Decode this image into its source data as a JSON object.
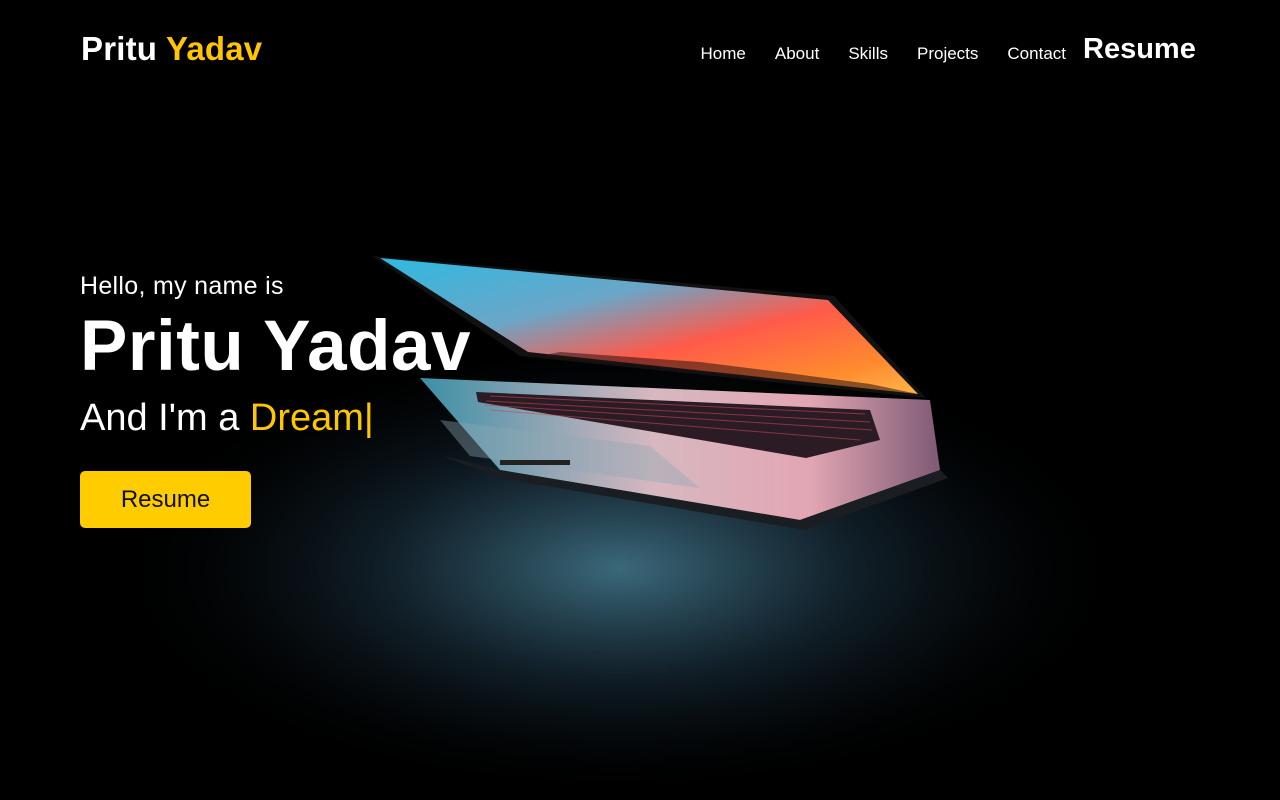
{
  "logo": {
    "first": "Pritu",
    "second": "Yadav",
    "accent_color": "#ffc600"
  },
  "nav": {
    "links": [
      {
        "label": "Home"
      },
      {
        "label": "About"
      },
      {
        "label": "Skills"
      },
      {
        "label": "Projects"
      },
      {
        "label": "Contact"
      }
    ],
    "resume_label": "Resume"
  },
  "hero": {
    "greeting": "Hello, my name is",
    "name": "Pritu Yadav",
    "role_prefix": "And I'm a ",
    "role_typed": "Dream",
    "cursor": "|",
    "button_label": "Resume",
    "button_color": "#ffcc00"
  },
  "background_image": "laptop-half-open-glowing-screen"
}
